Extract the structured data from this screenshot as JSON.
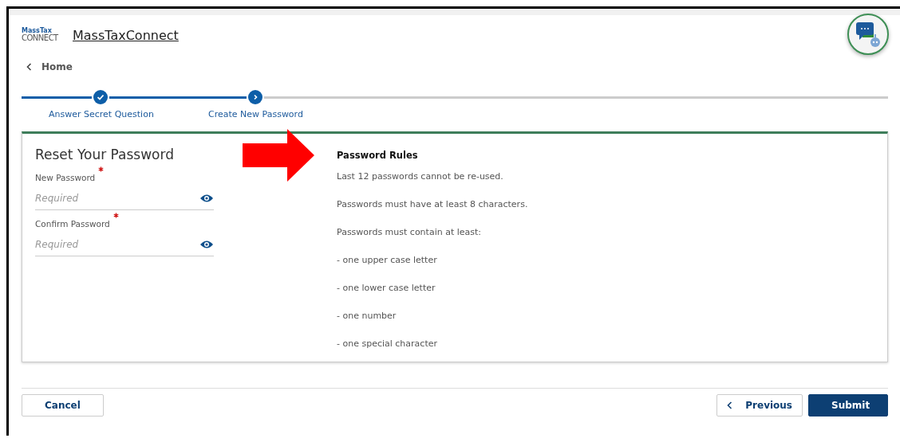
{
  "header": {
    "logo_top": "MassTax",
    "logo_bottom": "CONNECT",
    "title": "MassTaxConnect"
  },
  "breadcrumb": {
    "label": "Home"
  },
  "steps": [
    {
      "label": "Answer Secret Question",
      "completed": true,
      "selected": false
    },
    {
      "label": "Create New Password",
      "completed": false,
      "selected": true
    }
  ],
  "form": {
    "title": "Reset Your Password",
    "fields": [
      {
        "label": "New Password",
        "required": true,
        "placeholder": "Required"
      },
      {
        "label": "Confirm Password",
        "required": true,
        "placeholder": "Required"
      }
    ]
  },
  "rules": {
    "title": "Password Rules",
    "items": [
      "Last 12 passwords cannot be re-used.",
      "Passwords must have at least 8 characters.",
      "Passwords must contain at least:",
      "- one upper case letter",
      "- one lower case letter",
      "- one number",
      "- one special character"
    ]
  },
  "buttons": {
    "cancel": "Cancel",
    "previous": "Previous",
    "submit": "Submit"
  }
}
